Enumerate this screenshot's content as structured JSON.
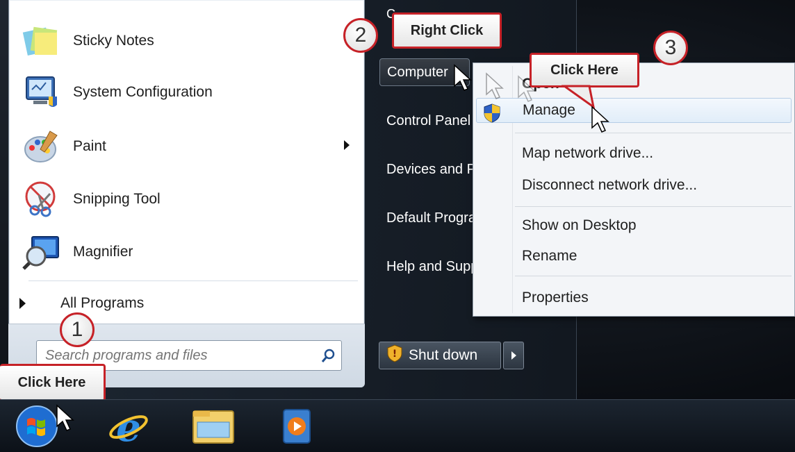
{
  "start_menu": {
    "programs": [
      {
        "label": "Sticky Notes",
        "icon": "sticky-notes-icon"
      },
      {
        "label": "System Configuration",
        "icon": "system-configuration-icon"
      },
      {
        "label": "Paint",
        "icon": "paint-icon",
        "has_submenu": true
      },
      {
        "label": "Snipping Tool",
        "icon": "snipping-tool-icon"
      },
      {
        "label": "Magnifier",
        "icon": "magnifier-icon"
      }
    ],
    "all_programs": "All Programs",
    "search_placeholder": "Search programs and files",
    "right_items": [
      {
        "label": "Computer"
      },
      {
        "label": "Control Panel"
      },
      {
        "label": "Devices and Printers"
      },
      {
        "label": "Default Programs"
      },
      {
        "label": "Help and Support"
      }
    ],
    "shutdown_label": "Shut down"
  },
  "context_menu": {
    "items": [
      {
        "label": "Open"
      },
      {
        "label": "Manage",
        "icon": "uac-shield-icon",
        "highlighted": true
      },
      {
        "label": "Map network drive..."
      },
      {
        "label": "Disconnect network drive..."
      },
      {
        "label": "Show on Desktop"
      },
      {
        "label": "Rename"
      },
      {
        "label": "Properties"
      }
    ]
  },
  "callouts": {
    "step1": {
      "number": "1",
      "text": "Click Here"
    },
    "step2": {
      "number": "2",
      "text": "Right Click"
    },
    "step3": {
      "number": "3",
      "text": "Click Here"
    }
  },
  "taskbar": {
    "icons": [
      "start-orb-icon",
      "internet-explorer-icon",
      "windows-explorer-icon",
      "media-player-icon"
    ]
  },
  "colors": {
    "callout_border": "#c62127",
    "menu_highlight": "#e1edf9"
  }
}
